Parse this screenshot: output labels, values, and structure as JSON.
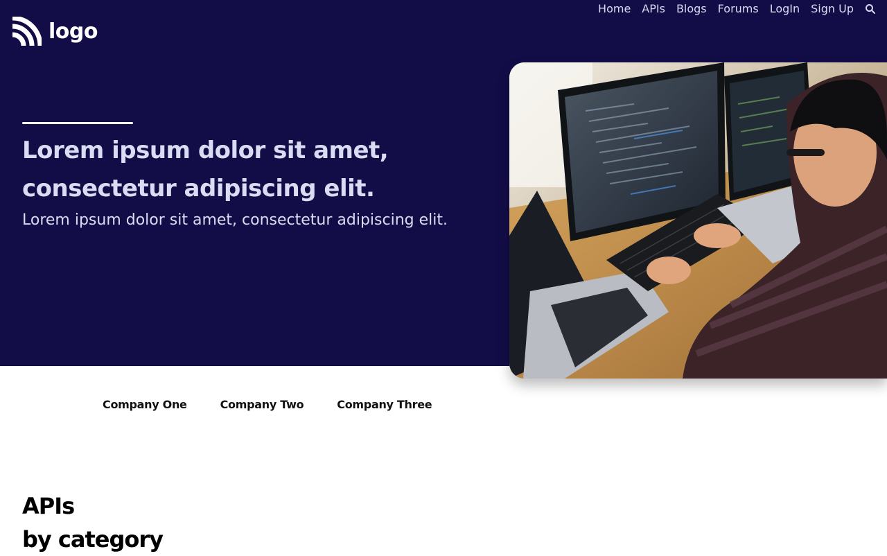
{
  "brand": {
    "logo_text": "logo",
    "logo_icon": "wifi-signal-icon",
    "background_color": "#130d47"
  },
  "nav": {
    "items": [
      {
        "label": "Home"
      },
      {
        "label": "APIs"
      },
      {
        "label": "Blogs"
      },
      {
        "label": "Forums"
      },
      {
        "label": "LogIn"
      },
      {
        "label": "Sign Up"
      }
    ],
    "search_icon": "search-icon"
  },
  "hero": {
    "title": "Lorem ipsum dolor sit amet, consectetur adipiscing elit.",
    "subtitle": "Lorem ipsum dolor sit amet, consectetur adipiscing elit.",
    "image_subject": "developer-at-computer-photo"
  },
  "companies": [
    {
      "name": "Company One"
    },
    {
      "name": "Company Two"
    },
    {
      "name": "Company Three"
    }
  ],
  "section": {
    "title_line1": "APIs",
    "title_line2": "by category"
  }
}
